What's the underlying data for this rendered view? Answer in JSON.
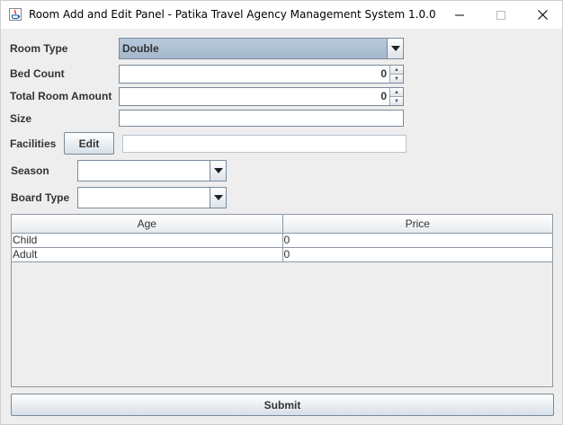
{
  "window": {
    "title": "Room Add and Edit Panel - Patika Travel Agency Management System 1.0.0"
  },
  "form": {
    "room_type": {
      "label": "Room Type",
      "value": "Double"
    },
    "bed_count": {
      "label": "Bed Count",
      "value": "0"
    },
    "total_room_amount": {
      "label": "Total Room Amount",
      "value": "0"
    },
    "size": {
      "label": "Size",
      "value": ""
    },
    "facilities": {
      "label": "Facilities",
      "button": "Edit",
      "value": ""
    },
    "season": {
      "label": "Season",
      "value": ""
    },
    "board_type": {
      "label": "Board Type",
      "value": ""
    }
  },
  "table": {
    "columns": [
      "Age",
      "Price"
    ],
    "rows": [
      [
        "Child",
        "0"
      ],
      [
        "Adult",
        "0"
      ]
    ]
  },
  "submit_label": "Submit"
}
